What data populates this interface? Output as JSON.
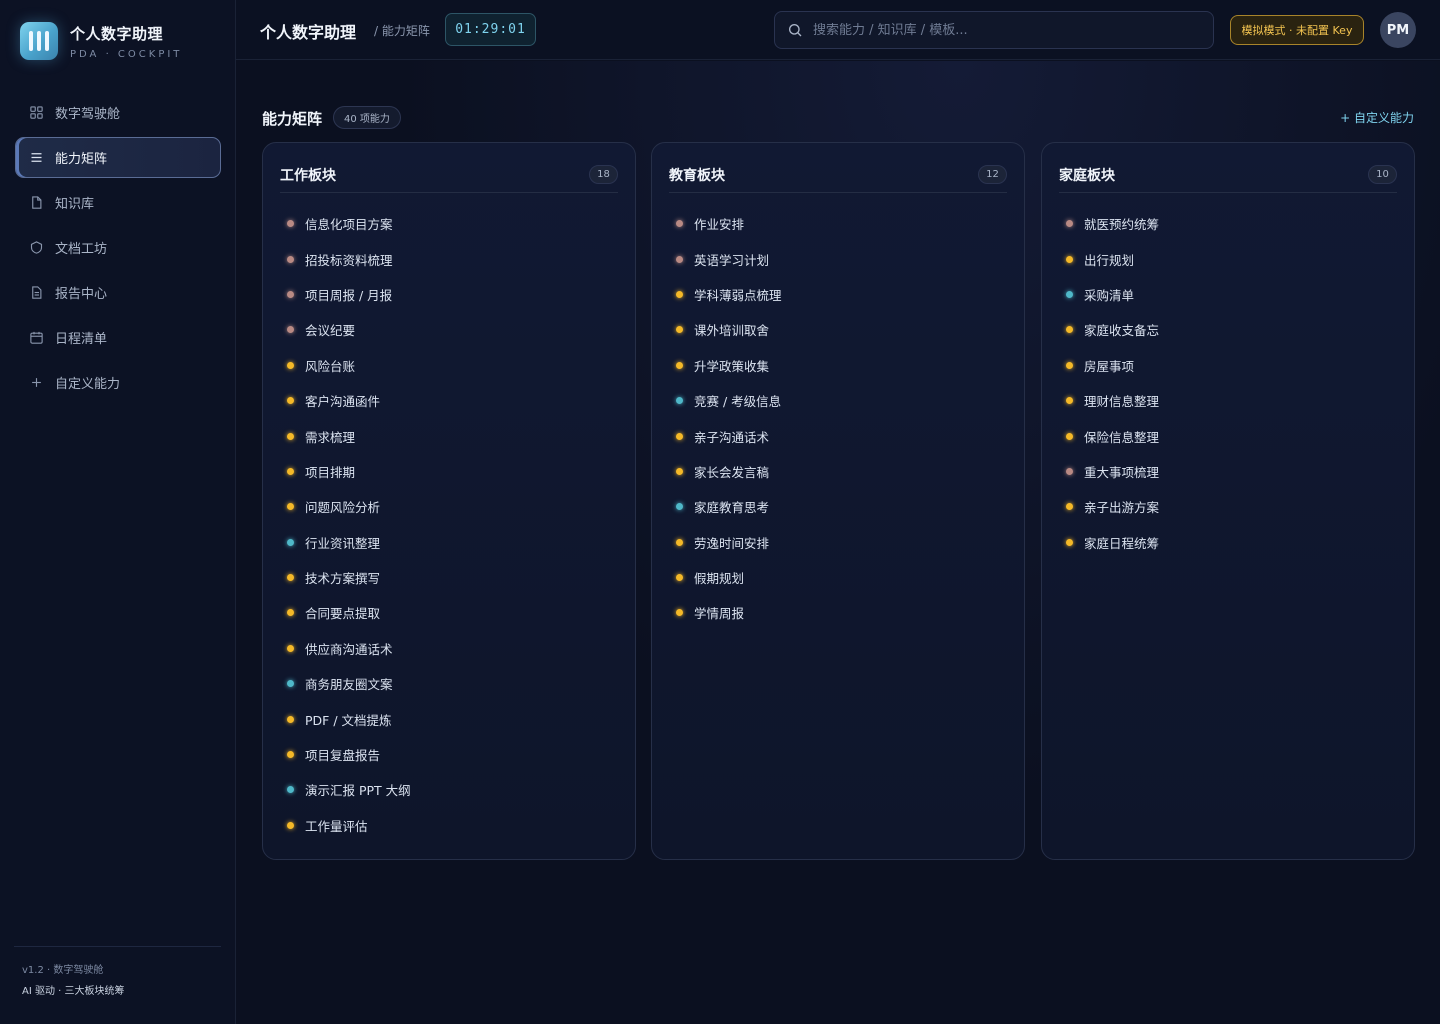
{
  "brand": {
    "title": "个人数字助理",
    "subtitle": "PDA · COCKPIT"
  },
  "nav": [
    {
      "label": "数字驾驶舱",
      "icon": "dashboard-icon",
      "active": false
    },
    {
      "label": "能力矩阵",
      "icon": "list-icon",
      "active": true
    },
    {
      "label": "知识库",
      "icon": "file-icon",
      "active": false
    },
    {
      "label": "文档工坊",
      "icon": "shield-icon",
      "active": false
    },
    {
      "label": "报告中心",
      "icon": "report-icon",
      "active": false
    },
    {
      "label": "日程清单",
      "icon": "calendar-icon",
      "active": false
    },
    {
      "label": "自定义能力",
      "icon": "plus-icon",
      "active": false
    }
  ],
  "footer": {
    "version": "v1.2 · 数字驾驶舱",
    "desc": "AI 驱动 · 三大板块统筹"
  },
  "header": {
    "title": "个人数字助理",
    "breadcrumb": "/ 能力矩阵",
    "clock": "01:29:01",
    "search_placeholder": "搜索能力 / 知识库 / 模板...",
    "mode_badge": "模拟模式 · 未配置 Key",
    "avatar": "PM"
  },
  "section": {
    "title": "能力矩阵",
    "count": "40 项能力",
    "custom_link": "+ 自定义能力"
  },
  "colors": {
    "rose": "#b98a84",
    "amber": "#f5b928",
    "teal": "#4fb8c9"
  },
  "boards": [
    {
      "name": "工作板块",
      "count": "18",
      "items": [
        {
          "label": "信息化项目方案",
          "tone": "rose"
        },
        {
          "label": "招投标资料梳理",
          "tone": "rose"
        },
        {
          "label": "项目周报 / 月报",
          "tone": "rose"
        },
        {
          "label": "会议纪要",
          "tone": "rose"
        },
        {
          "label": "风险台账",
          "tone": "amber"
        },
        {
          "label": "客户沟通函件",
          "tone": "amber"
        },
        {
          "label": "需求梳理",
          "tone": "amber"
        },
        {
          "label": "项目排期",
          "tone": "amber"
        },
        {
          "label": "问题风险分析",
          "tone": "amber"
        },
        {
          "label": "行业资讯整理",
          "tone": "teal"
        },
        {
          "label": "技术方案撰写",
          "tone": "amber"
        },
        {
          "label": "合同要点提取",
          "tone": "amber"
        },
        {
          "label": "供应商沟通话术",
          "tone": "amber"
        },
        {
          "label": "商务朋友圈文案",
          "tone": "teal"
        },
        {
          "label": "PDF / 文档提炼",
          "tone": "amber"
        },
        {
          "label": "项目复盘报告",
          "tone": "amber"
        },
        {
          "label": "演示汇报 PPT 大纲",
          "tone": "teal"
        },
        {
          "label": "工作量评估",
          "tone": "amber"
        }
      ]
    },
    {
      "name": "教育板块",
      "count": "12",
      "items": [
        {
          "label": "作业安排",
          "tone": "rose"
        },
        {
          "label": "英语学习计划",
          "tone": "rose"
        },
        {
          "label": "学科薄弱点梳理",
          "tone": "amber"
        },
        {
          "label": "课外培训取舍",
          "tone": "amber"
        },
        {
          "label": "升学政策收集",
          "tone": "amber"
        },
        {
          "label": "竞赛 / 考级信息",
          "tone": "teal"
        },
        {
          "label": "亲子沟通话术",
          "tone": "amber"
        },
        {
          "label": "家长会发言稿",
          "tone": "amber"
        },
        {
          "label": "家庭教育思考",
          "tone": "teal"
        },
        {
          "label": "劳逸时间安排",
          "tone": "amber"
        },
        {
          "label": "假期规划",
          "tone": "amber"
        },
        {
          "label": "学情周报",
          "tone": "amber"
        }
      ]
    },
    {
      "name": "家庭板块",
      "count": "10",
      "items": [
        {
          "label": "就医预约统筹",
          "tone": "rose"
        },
        {
          "label": "出行规划",
          "tone": "amber"
        },
        {
          "label": "采购清单",
          "tone": "teal"
        },
        {
          "label": "家庭收支备忘",
          "tone": "amber"
        },
        {
          "label": "房屋事项",
          "tone": "amber"
        },
        {
          "label": "理财信息整理",
          "tone": "amber"
        },
        {
          "label": "保险信息整理",
          "tone": "amber"
        },
        {
          "label": "重大事项梳理",
          "tone": "rose"
        },
        {
          "label": "亲子出游方案",
          "tone": "amber"
        },
        {
          "label": "家庭日程统筹",
          "tone": "amber"
        }
      ]
    }
  ]
}
